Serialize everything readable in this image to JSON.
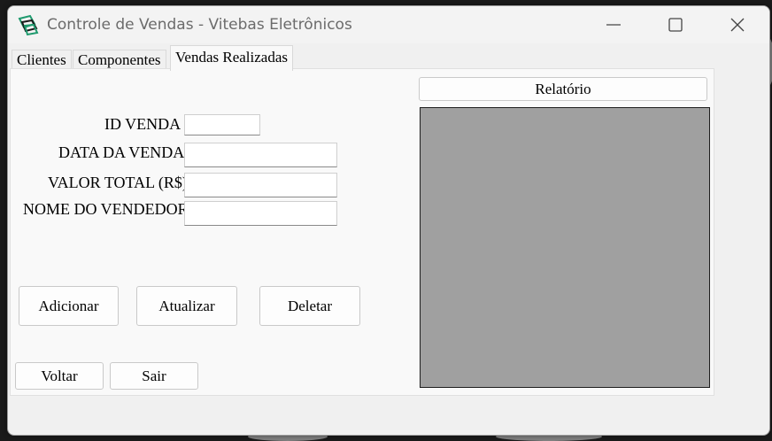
{
  "window": {
    "title": "Controle de Vendas - Vitebas Eletrônicos",
    "controls": {
      "minimize": "minimize-icon",
      "maximize": "maximize-icon",
      "close": "close-icon"
    }
  },
  "tabs": [
    {
      "label": "Clientes",
      "active": false
    },
    {
      "label": "Componentes",
      "active": false
    },
    {
      "label": "Vendas Realizadas",
      "active": true
    }
  ],
  "form": {
    "id_venda": {
      "label": "ID VENDA",
      "value": ""
    },
    "data_venda": {
      "label": "DATA DA VENDA",
      "value": ""
    },
    "valor_total": {
      "label": "VALOR TOTAL (R$)",
      "value": ""
    },
    "nome_vendedor": {
      "label": "NOME DO VENDEDOR",
      "value": ""
    }
  },
  "buttons": {
    "adicionar": "Adicionar",
    "atualizar": "Atualizar",
    "deletar": "Deletar",
    "voltar": "Voltar",
    "sair": "Sair",
    "relatorio": "Relatório"
  },
  "colors": {
    "report_area": "#a0a0a0",
    "icon_accent": "#1f9a6e"
  }
}
